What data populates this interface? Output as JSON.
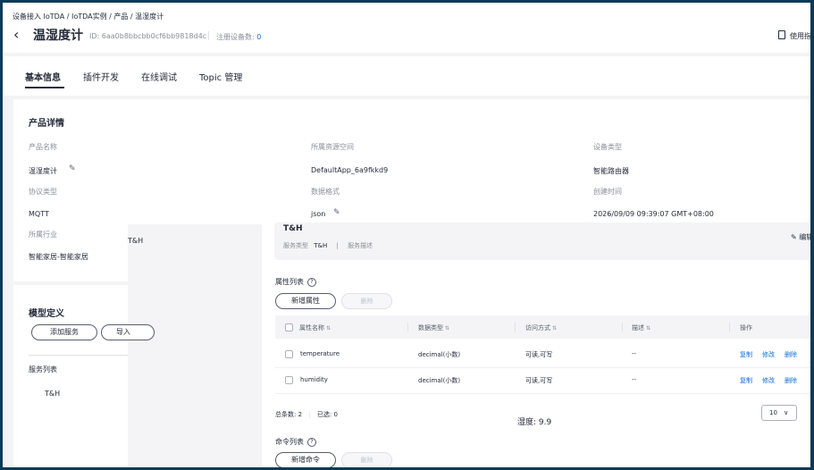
{
  "breadcrumb": "设备接入 IoTDA / IoTDA实例 / 产品 / 温湿度计",
  "header": {
    "back_icon": "back-icon",
    "title": "温湿度计",
    "id_text": "ID: 6aa0b8bbcbb0cf6bb9818d4c",
    "registered_label": "注册设备数:",
    "registered_count": "0",
    "doc_label": "使用指"
  },
  "tabs": [
    {
      "label": "基本信息",
      "active": true
    },
    {
      "label": "插件开发"
    },
    {
      "label": "在线调试"
    },
    {
      "label": "Topic 管理"
    }
  ],
  "product_details": {
    "title": "产品详情",
    "fields": [
      {
        "label": "产品名称",
        "value": "温湿度计"
      },
      {
        "label": "所属资源空间",
        "value": "DefaultApp_6a9fkkd9"
      },
      {
        "label": "设备类型",
        "value": "智能路由器"
      },
      {
        "label": "协议类型",
        "value": "MQTT"
      },
      {
        "label": "数据格式",
        "value": "json"
      },
      {
        "label": "创建时间",
        "value": "2026/09/09 09:39:07 GMT+08:00"
      },
      {
        "label": "所属行业",
        "value": "智能家居-智能家居"
      }
    ]
  },
  "stray_label": "T&H",
  "model": {
    "title": "模型定义",
    "add_service": "添加服务",
    "import_button": "导入",
    "service_list_label": "服务列表",
    "service_item": "T&H"
  },
  "service_panel": {
    "title": "T&H",
    "type_label": "服务类型",
    "type_value": "T&H",
    "divider": "|",
    "desc_label": "服务描述",
    "edit_label": "编辑"
  },
  "properties": {
    "title": "属性列表",
    "add_button": "新增属性",
    "delete_button": "删除",
    "columns": [
      "属性名称",
      "数据类型",
      "访问方式",
      "描述",
      "操作"
    ],
    "rows": [
      {
        "name": "temperature",
        "type": "decimal(小数)",
        "access": "可读,可写",
        "desc": "--"
      },
      {
        "name": "humidity",
        "type": "decimal(小数)",
        "access": "可读,可写",
        "desc": "--"
      }
    ],
    "actions": [
      "复制",
      "修改",
      "删除"
    ],
    "total_label": "总条数:",
    "total_value": "2",
    "selected_label": "已选:",
    "selected_value": "0",
    "page_size": "10"
  },
  "overlay_text": "湿度: 9.9",
  "commands": {
    "title": "命令列表",
    "add_button": "新增命令",
    "delete_button": "删除"
  },
  "colors": {
    "link": "#0c6fe2",
    "border": "#0b3a57"
  }
}
